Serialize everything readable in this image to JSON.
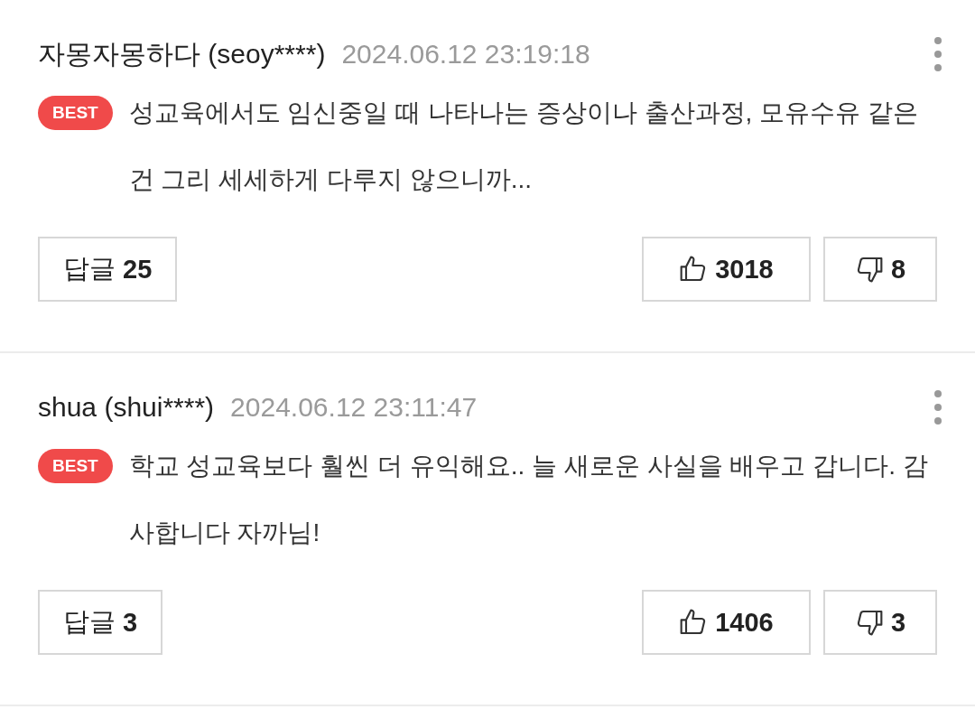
{
  "comments": [
    {
      "nickname": "자몽자몽하다",
      "user_id": "(seoy****)",
      "date": "2024.06.12 23:19:18",
      "best": true,
      "badge": "BEST",
      "text": "성교육에서도 임신중일 때 나타나는 증상이나 출산과정, 모유수유 같은 건 그리 세세하게 다루지 않으니까...",
      "reply_label": "답글",
      "reply_count": "25",
      "likes": "3018",
      "dislikes": "8"
    },
    {
      "nickname": "shua",
      "user_id": "(shui****)",
      "date": "2024.06.12 23:11:47",
      "best": true,
      "badge": "BEST",
      "text": "학교 성교육보다 훨씬 더 유익해요.. 늘 새로운 사실을 배우고 갑니다. 감사합니다 자까님!",
      "reply_label": "답글",
      "reply_count": "3",
      "likes": "1406",
      "dislikes": "3"
    }
  ]
}
